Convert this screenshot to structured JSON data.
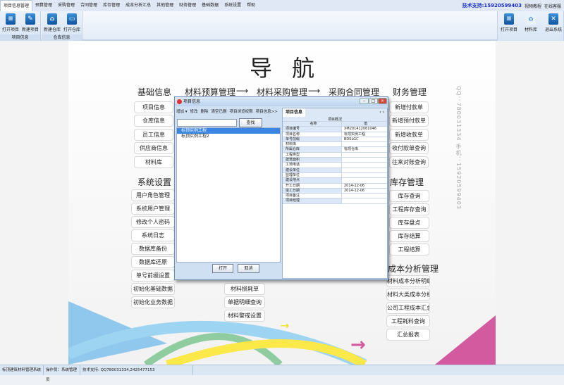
{
  "menu": [
    "项目信息管理",
    "预算管理",
    "采购管理",
    "合同管理",
    "库存管理",
    "成本分析汇总",
    "其他管理",
    "财务管理",
    "基础数据",
    "系统设置",
    "帮助"
  ],
  "support": "技术支持:15920599403",
  "top_links": [
    "视频教程",
    "在线客服"
  ],
  "ribbon": {
    "groups": [
      {
        "label": "项目信息",
        "buttons": [
          "打开项目",
          "新建项目"
        ]
      },
      {
        "label": "仓库信息",
        "buttons": [
          "新建仓库",
          "打开仓库"
        ]
      }
    ],
    "right_buttons": [
      "打开项目",
      "材料库",
      "退出系统"
    ]
  },
  "nav_title": "导航",
  "headers": {
    "basic": "基础信息",
    "chain": [
      "材料预算管理",
      "材料采购管理",
      "采购合同管理"
    ],
    "arrow": "⟶",
    "finance": "财务管理",
    "system": "系统设置",
    "stock": "库存管理",
    "cost": "成本分析管理"
  },
  "basic_items": [
    "项目信息",
    "仓库信息",
    "员工信息",
    "供应商信息",
    "材料库"
  ],
  "system_items": [
    "用户角色管理",
    "系统用户管理",
    "修改个人密码",
    "系统日志",
    "数据库备份",
    "数据库还原",
    "单号前缀设置",
    "初始化基础数据",
    "初始化业务数据"
  ],
  "middle_items": [
    "材料损耗单",
    "单据明细查询",
    "材料警戒设置"
  ],
  "finance_items": [
    "新增付款单",
    "新增预付款单",
    "新增收款单",
    "收付款单查询",
    "往来对账查询"
  ],
  "stock_items": [
    "库存查询",
    "工程库存查询",
    "库存盘点",
    "库存结算",
    "工程结算"
  ],
  "cost_items": [
    "材料成本分析明细",
    "材料大类成本分析",
    "公司工程成本汇总",
    "工程耗料查询",
    "汇总报表"
  ],
  "contact": "QQ：780031334  手机：15920599403",
  "dialog": {
    "title": "项目信息",
    "toolbar": [
      "增加 ▾",
      "修改",
      "删除",
      "清空已删",
      "项目浏览权限",
      "项目信息>>"
    ],
    "search_value": "",
    "search_button": "查找",
    "tree": [
      "标顶实例工程",
      "标顶实例工程2"
    ],
    "open": "打开",
    "cancel": "取消",
    "tab": "项目信息",
    "group_title": "项目概况",
    "col_name": "名称",
    "col_value": "值",
    "rows": [
      [
        "项目编号",
        "XM201412061046"
      ],
      [
        "项目名称",
        "标顶实例工程"
      ],
      [
        "单号前缀",
        "BDSLGC"
      ],
      [
        "材料库",
        ""
      ],
      [
        "所属仓库",
        "标顶仓库"
      ],
      [
        "工程类型",
        ""
      ],
      [
        "建筑面积",
        ""
      ],
      [
        "工地电话",
        ""
      ],
      [
        "建设单位",
        ""
      ],
      [
        "监理单位",
        ""
      ],
      [
        "建设地点",
        ""
      ],
      [
        "开工日期",
        "2014-12-06"
      ],
      [
        "竣工日期",
        "2014-12-06"
      ],
      [
        "项目备注",
        ""
      ],
      [
        "项目经理",
        ""
      ]
    ]
  },
  "status": [
    "标顶建筑材料管理系统",
    "操作员：系统管理员",
    "技术支持: QQ780031334,2425477153"
  ]
}
